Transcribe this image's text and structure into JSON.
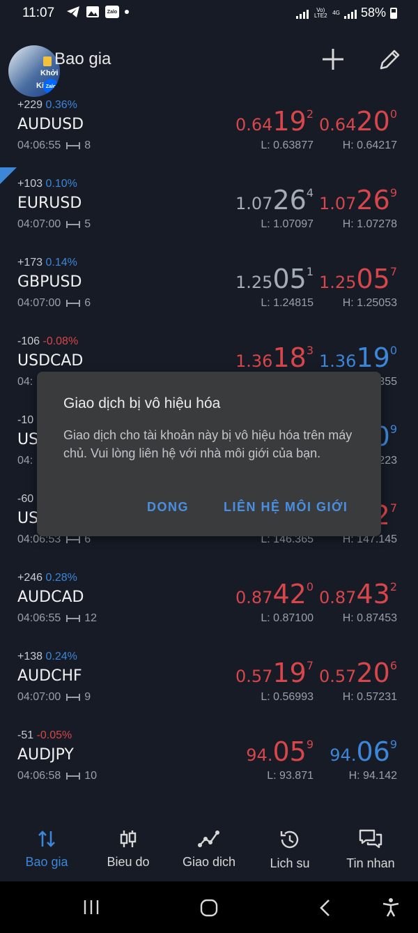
{
  "status_bar": {
    "time": "11:07",
    "network": "4G",
    "volte": "Vo) LTE2",
    "battery": "58%",
    "zalo_label": "Zalo"
  },
  "header": {
    "title": "Bao gia",
    "avatar_text_1": "Khởi",
    "avatar_text_2": "Kir",
    "avatar_badge": "Zalo",
    "add_icon": "plus-icon",
    "edit_icon": "pencil-icon"
  },
  "quotes": [
    {
      "change": "+229",
      "pct": "0.36%",
      "pct_sign": "pos",
      "symbol": "AUDUSD",
      "time": "04:06:55",
      "spread": "8",
      "bid": {
        "small": "0.64",
        "big": "19",
        "sup": "2",
        "color": "red"
      },
      "ask": {
        "small": "0.64",
        "big": "20",
        "sup": "0",
        "color": "red"
      },
      "low": "L: 0.63877",
      "high": "H: 0.64217"
    },
    {
      "change": "+103",
      "pct": "0.10%",
      "pct_sign": "pos",
      "symbol": "EURUSD",
      "time": "04:07:00",
      "spread": "5",
      "bid": {
        "small": "1.07",
        "big": "26",
        "sup": "4",
        "color": "gray"
      },
      "ask": {
        "small": "1.07",
        "big": "26",
        "sup": "9",
        "color": "red"
      },
      "low": "L: 1.07097",
      "high": "H: 1.07278"
    },
    {
      "change": "+173",
      "pct": "0.14%",
      "pct_sign": "pos",
      "symbol": "GBPUSD",
      "time": "04:07:00",
      "spread": "6",
      "bid": {
        "small": "1.25",
        "big": "05",
        "sup": "1",
        "color": "gray"
      },
      "ask": {
        "small": "1.25",
        "big": "05",
        "sup": "7",
        "color": "red"
      },
      "low": "L: 1.24815",
      "high": "H: 1.25053"
    },
    {
      "change": "-106",
      "pct": "-0.08%",
      "pct_sign": "neg",
      "symbol": "USDCAD",
      "time": "04:",
      "spread": "",
      "bid": {
        "small": "1.36",
        "big": "18",
        "sup": "3",
        "color": "red"
      },
      "ask": {
        "small": "1.36",
        "big": "19",
        "sup": "0",
        "color": "blue"
      },
      "low": "",
      "high": "355"
    },
    {
      "change": "-10",
      "pct": "",
      "pct_sign": "neg",
      "symbol": "US",
      "time": "04:",
      "spread": "",
      "bid": {
        "small": "",
        "big": "",
        "sup": "",
        "color": "red"
      },
      "ask": {
        "small": "",
        "big": "0",
        "sup": "9",
        "color": "blue"
      },
      "low": "",
      "high": "223"
    },
    {
      "change": "-60",
      "pct": "",
      "pct_sign": "neg",
      "symbol": "US",
      "time": "04:06:53",
      "spread": "6",
      "bid": {
        "small": "",
        "big": "",
        "sup": "",
        "color": "red"
      },
      "ask": {
        "small": "",
        "big": "2",
        "sup": "7",
        "color": "red"
      },
      "low": "L: 146.365",
      "high": "H: 147.145"
    },
    {
      "change": "+246",
      "pct": "0.28%",
      "pct_sign": "pos",
      "symbol": "AUDCAD",
      "time": "04:06:55",
      "spread": "12",
      "bid": {
        "small": "0.87",
        "big": "42",
        "sup": "0",
        "color": "red"
      },
      "ask": {
        "small": "0.87",
        "big": "43",
        "sup": "2",
        "color": "red"
      },
      "low": "L: 0.87100",
      "high": "H: 0.87453"
    },
    {
      "change": "+138",
      "pct": "0.24%",
      "pct_sign": "pos",
      "symbol": "AUDCHF",
      "time": "04:07:00",
      "spread": "9",
      "bid": {
        "small": "0.57",
        "big": "19",
        "sup": "7",
        "color": "red"
      },
      "ask": {
        "small": "0.57",
        "big": "20",
        "sup": "6",
        "color": "red"
      },
      "low": "L: 0.56993",
      "high": "H: 0.57231"
    },
    {
      "change": "-51",
      "pct": "-0.05%",
      "pct_sign": "neg",
      "symbol": "AUDJPY",
      "time": "04:06:58",
      "spread": "10",
      "bid": {
        "small": "94.",
        "big": "05",
        "sup": "9",
        "color": "red"
      },
      "ask": {
        "small": "94.",
        "big": "06",
        "sup": "9",
        "color": "blue"
      },
      "low": "L: 93.871",
      "high": "H: 94.142"
    }
  ],
  "dialog": {
    "title": "Giao dịch bị vô hiệu hóa",
    "message": "Giao dịch cho tài khoản này bị vô hiệu hóa trên máy chủ. Vui lòng liên hệ với nhà môi giới của bạn.",
    "dismiss_label": "DONG",
    "contact_label": "LIÊN HỆ MÔI GIỚI"
  },
  "bottom_nav": [
    {
      "label": "Bao gia",
      "icon": "arrows-updown-icon",
      "active": true
    },
    {
      "label": "Bieu do",
      "icon": "candlestick-icon",
      "active": false
    },
    {
      "label": "Giao dich",
      "icon": "trend-line-icon",
      "active": false
    },
    {
      "label": "Lich su",
      "icon": "history-icon",
      "active": false
    },
    {
      "label": "Tin nhan",
      "icon": "chat-icon",
      "active": false
    }
  ],
  "colors": {
    "background": "#161b26",
    "accent": "#3d86d8",
    "down": "#d6464a",
    "dialog": "#3a3b3c"
  }
}
